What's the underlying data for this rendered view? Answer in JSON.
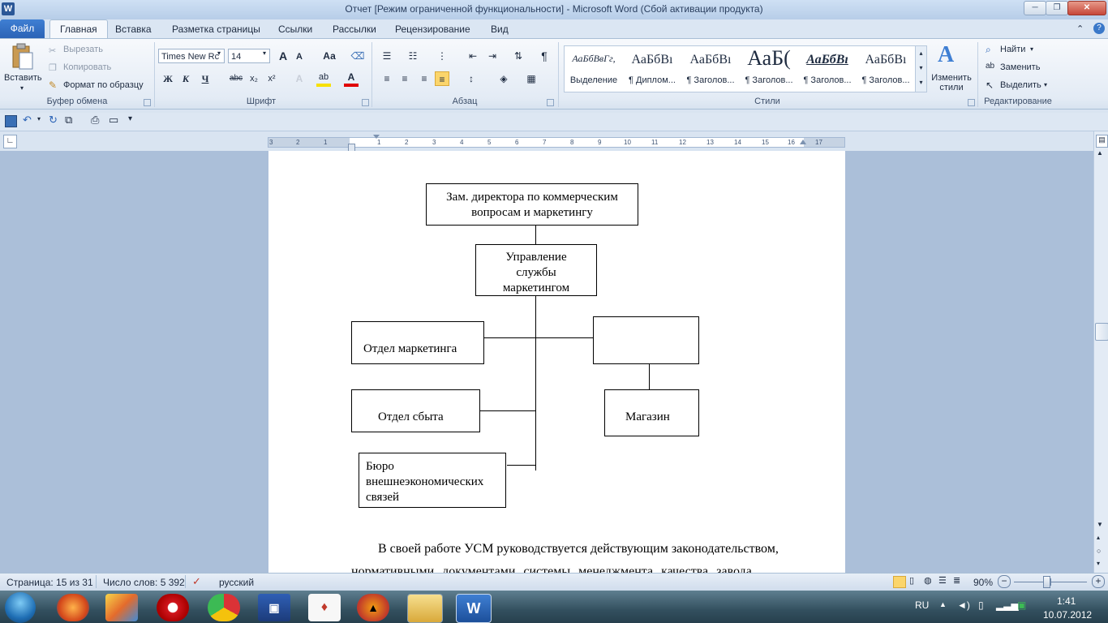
{
  "window": {
    "title": "Отчет [Режим ограниченной функциональности]  -  Microsoft Word (Сбой активации продукта)",
    "app_icon": "W",
    "minimize_label": "─",
    "maximize_label": "❐",
    "close_label": "✕"
  },
  "tabs": {
    "file": "Файл",
    "items": [
      "Главная",
      "Вставка",
      "Разметка страницы",
      "Ссылки",
      "Рассылки",
      "Рецензирование",
      "Вид"
    ]
  },
  "ribbon": {
    "clipboard": {
      "paste": "Вставить",
      "cut": "Вырезать",
      "copy": "Копировать",
      "format_painter": "Формат по образцу",
      "label": "Буфер обмена"
    },
    "font": {
      "name": "Times New Rc",
      "size": "14",
      "label": "Шрифт",
      "bold": "Ж",
      "italic": "К",
      "underline": "Ч",
      "strike": "abc",
      "subscript": "x₂",
      "superscript": "x²",
      "grow": "A",
      "shrink": "A",
      "case": "Аа",
      "highlight_color": "#f7e000",
      "font_color": "#e00000"
    },
    "paragraph": {
      "label": "Абзац",
      "pilcrow": "¶"
    },
    "styles": {
      "label": "Стили",
      "items": [
        {
          "sample": "АаБбВвГг,",
          "name": "Выделение"
        },
        {
          "sample": "АаБбВı",
          "name": "¶ Диплом..."
        },
        {
          "sample": "АаБбВı",
          "name": "¶ Заголов..."
        },
        {
          "sample": "АаБ(",
          "name": "¶ Заголов..."
        },
        {
          "sample": "АаБбВı",
          "name": "¶ Заголов..."
        },
        {
          "sample": "АаБбВı",
          "name": "¶ Заголов..."
        }
      ],
      "change_styles": "Изменить стили"
    },
    "editing": {
      "label": "Редактирование",
      "find": "Найти",
      "replace": "Заменить",
      "select": "Выделить"
    }
  },
  "ruler": {
    "ticks": [
      "3",
      "2",
      "1",
      "1",
      "2",
      "3",
      "4",
      "5",
      "6",
      "7",
      "8",
      "9",
      "10",
      "11",
      "12",
      "13",
      "14",
      "15",
      "16",
      "17"
    ]
  },
  "document": {
    "org_chart": {
      "deputy_director": "Зам. директора по коммерческим вопросам и маркетингу",
      "marketing_management": "Управление службы маркетингом",
      "marketing_department": "Отдел маркетинга",
      "unnamed_box": "",
      "sales_department": "Отдел сбыта",
      "shop": "Магазин",
      "foreign_bureau": "Бюро внешнеэкономических связей"
    },
    "paragraph_line1": "В своей работе УСМ руководствуется действующим законодательством,",
    "paragraph_line2": "нормативными  документами   системы  менеджмента  качества  завода,"
  },
  "status_bar": {
    "page": "Страница: 15 из 31",
    "words": "Число слов: 5 392",
    "language": "русский",
    "zoom": "90%",
    "zoom_level": 0.9
  },
  "taskbar": {
    "language": "RU",
    "time": "1:41",
    "date": "10.07.2012",
    "apps": [
      "start-orb",
      "firefox",
      "paint",
      "opera",
      "chrome",
      "save-disk",
      "cards-game",
      "vlc",
      "explorer",
      "word"
    ]
  },
  "colors": {
    "file_tab": "#2b63b6",
    "ribbon_bg": "#e3ebf5",
    "doc_bg": "#abbfd9",
    "taskbar": "#33505f"
  }
}
